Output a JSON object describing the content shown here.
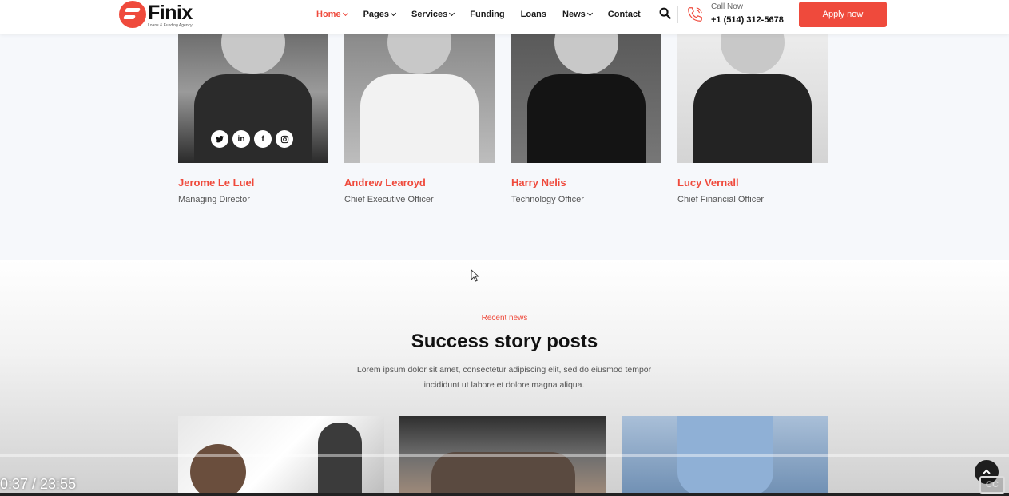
{
  "header": {
    "logo_name": "Finix",
    "logo_tagline": "Loans & Funding Agency",
    "nav": [
      {
        "label": "Home",
        "dropdown": true,
        "active": true
      },
      {
        "label": "Pages",
        "dropdown": true
      },
      {
        "label": "Services",
        "dropdown": true
      },
      {
        "label": "Funding",
        "dropdown": false
      },
      {
        "label": "Loans",
        "dropdown": false
      },
      {
        "label": "News",
        "dropdown": true
      },
      {
        "label": "Contact",
        "dropdown": false
      }
    ],
    "call_label": "Call Now",
    "call_number": "+1 (514) 312-5678",
    "apply_label": "Apply now"
  },
  "team": {
    "members": [
      {
        "name": "Jerome Le Luel",
        "role": "Managing Director"
      },
      {
        "name": "Andrew Learoyd",
        "role": "Chief Executive Officer"
      },
      {
        "name": "Harry Nelis",
        "role": "Technology Officer"
      },
      {
        "name": "Lucy Vernall",
        "role": "Chief Financial Officer"
      }
    ],
    "social_icons": [
      "twitter-icon",
      "linkedin-icon",
      "facebook-icon",
      "instagram-icon"
    ]
  },
  "news": {
    "eyebrow": "Recent news",
    "title": "Success story posts",
    "description": "Lorem ipsum dolor sit amet, consectetur adipiscing elit, sed do eiusmod tempor incididunt ut labore et dolore magna aliqua."
  },
  "video": {
    "timecode": "0:37 / 23:55",
    "cc_label": "CC"
  },
  "colors": {
    "accent": "#ef4a3c",
    "text_dark": "#111111",
    "background": "#f6f8fb"
  }
}
